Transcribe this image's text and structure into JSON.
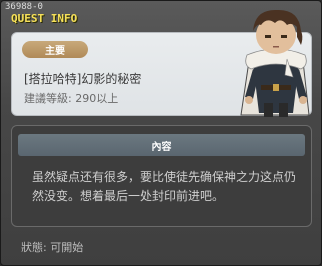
{
  "window": {
    "quest_id": "36988-0",
    "title": "QUEST INFO"
  },
  "quest": {
    "type_badge": "主要",
    "name": "[搭拉哈特]幻影的秘密",
    "recommended_level": "建議等級: 290以上"
  },
  "content": {
    "header": "內容",
    "text": "虽然疑点还有很多，要比使徒先确保神之力这点仍\n然没变。想着最后一处封印前进吧。"
  },
  "status": {
    "text": "狀態: 可開始"
  },
  "colors": {
    "title_yellow": "#f7e15a",
    "badge_tan": "#b08a58",
    "header_slate": "#5a6670"
  },
  "npc_portrait": {
    "icon": "npc-character-portrait"
  }
}
